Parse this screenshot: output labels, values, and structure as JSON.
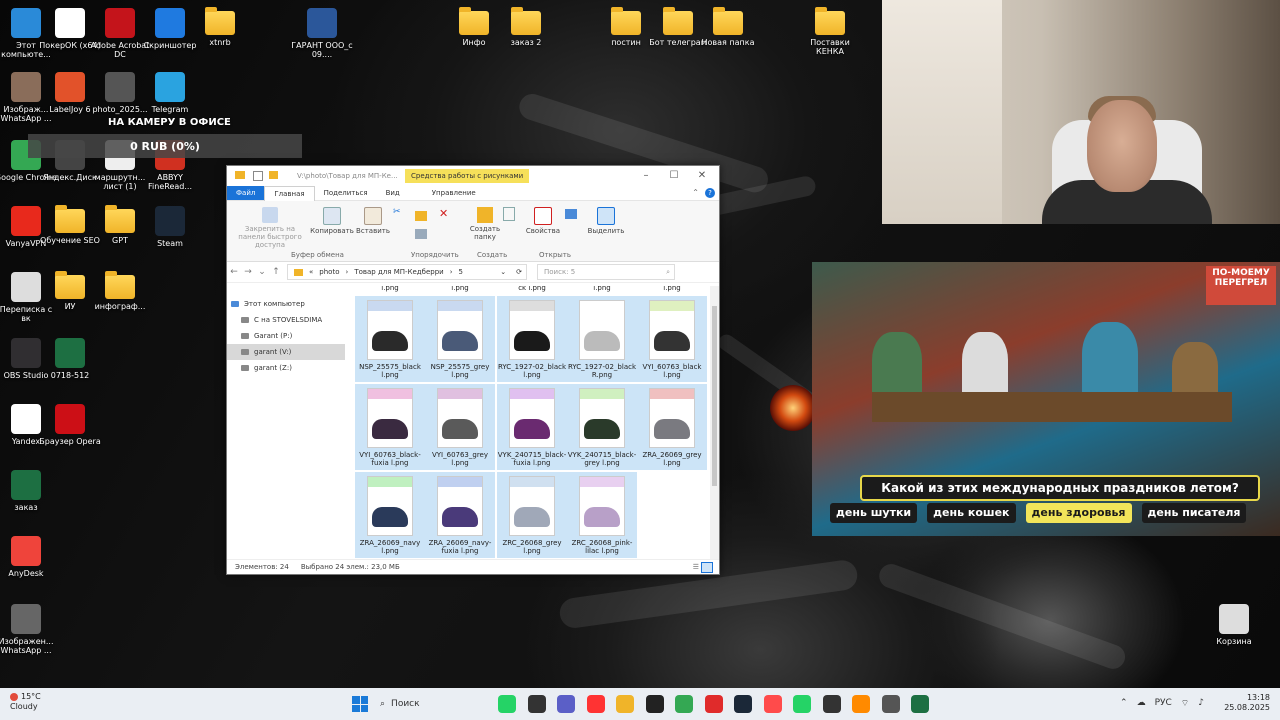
{
  "desktop": {
    "icons": [
      {
        "label": "Этот компьюте...",
        "icon": "computer-icon",
        "color": "#2a8ad8"
      },
      {
        "label": "ПокерОК (x64)",
        "icon": "poker-icon",
        "color": "#ffffff"
      },
      {
        "label": "Adobe Acrobat DC",
        "icon": "acrobat-icon",
        "color": "#c4141b"
      },
      {
        "label": "Скриншотер",
        "icon": "screenshot-icon",
        "color": "#1f7ae0"
      },
      {
        "label": "xtnrb",
        "icon": "folder-icon",
        "color": "#f0b429"
      },
      {
        "label": "ГАРАНТ ООО_с 09....",
        "icon": "word-icon",
        "color": "#2b579a"
      },
      {
        "label": "Изображ... WhatsApp ...",
        "icon": "image-icon",
        "color": "#8a6d5a"
      },
      {
        "label": "LabelJoy 6",
        "icon": "labeljoy-icon",
        "color": "#e2522a"
      },
      {
        "label": "photo_2025...",
        "icon": "image-icon",
        "color": "#555555"
      },
      {
        "label": "Telegram",
        "icon": "telegram-icon",
        "color": "#2aa3e0"
      },
      {
        "label": "Google Chrome",
        "icon": "chrome-icon",
        "color": "#34a853"
      },
      {
        "label": "Яндекс.Диск",
        "icon": "yandex-disk-icon",
        "color": "#444444"
      },
      {
        "label": "маршрутн... лист (1)",
        "icon": "document-icon",
        "color": "#eeeeee"
      },
      {
        "label": "ABBYY FineRead...",
        "icon": "abbyy-icon",
        "color": "#d03020"
      },
      {
        "label": "VanyaVPN",
        "icon": "vpn-icon",
        "color": "#e8291c"
      },
      {
        "label": "Обучение SEO",
        "icon": "folder-icon",
        "color": "#f0b429"
      },
      {
        "label": "GPT",
        "icon": "folder-icon",
        "color": "#f0b429"
      },
      {
        "label": "Steam",
        "icon": "steam-icon",
        "color": "#1b2838"
      },
      {
        "label": "Переписка с вк",
        "icon": "document-icon",
        "color": "#dddddd"
      },
      {
        "label": "ИУ",
        "icon": "folder-icon",
        "color": "#f0b429"
      },
      {
        "label": "инфограф...",
        "icon": "folder-icon",
        "color": "#f0b429"
      },
      {
        "label": "OBS Studio",
        "icon": "obs-icon",
        "color": "#302e31"
      },
      {
        "label": "0718-512",
        "icon": "excel-icon",
        "color": "#1d6f42"
      },
      {
        "label": "Yandex",
        "icon": "yandex-browser-icon",
        "color": "#ffffff"
      },
      {
        "label": "Браузер Opera",
        "icon": "opera-icon",
        "color": "#cc0f16"
      },
      {
        "label": "заказ",
        "icon": "excel-icon",
        "color": "#1d6f42"
      },
      {
        "label": "AnyDesk",
        "icon": "anydesk-icon",
        "color": "#ef443b"
      },
      {
        "label": "Изображен... WhatsApp ...",
        "icon": "image-icon",
        "color": "#666666"
      },
      {
        "label": "Инфо",
        "icon": "folder-icon",
        "color": "#f0b429"
      },
      {
        "label": "заказ 2",
        "icon": "folder-icon",
        "color": "#f0b429"
      },
      {
        "label": "постин",
        "icon": "folder-icon",
        "color": "#f0b429"
      },
      {
        "label": "Бот телеграм",
        "icon": "folder-icon",
        "color": "#f0b429"
      },
      {
        "label": "Новая папка",
        "icon": "folder-icon",
        "color": "#f0b429"
      },
      {
        "label": "Поставки КЕНКА",
        "icon": "folder-icon",
        "color": "#f0b429"
      },
      {
        "label": "Корзина",
        "icon": "recycle-bin-icon",
        "color": "#dddddd"
      }
    ],
    "camera_label": "НА КАМЕРУ В ОФИСЕ",
    "donation_bar": "0 RUB (0%)"
  },
  "explorer": {
    "title_path": "V:\\photo\\Товар для МП-Ке...",
    "tools_tab": "Средства работы с рисунками",
    "tabs": {
      "file": "Файл",
      "home": "Главная",
      "share": "Поделиться",
      "view": "Вид",
      "manage": "Управление"
    },
    "ribbon": {
      "pin": "Закрепить на панели быстрого доступа",
      "copy": "Копировать",
      "paste": "Вставить",
      "new_folder": "Создать папку",
      "properties": "Свойства",
      "select": "Выделить",
      "group_clipboard": "Буфер обмена",
      "group_organize": "Упорядочить",
      "group_new": "Создать",
      "group_open": "Открыть"
    },
    "address": {
      "crumbs": [
        "«",
        "photo",
        "›",
        "Товар для МП-Кедберри",
        "›",
        "5"
      ],
      "search_placeholder": "Поиск: 5"
    },
    "nav": [
      "Этот компьютер",
      "C на STOVELSDIMA",
      "Garant (P:)",
      "garant (V:)",
      "garant (Z:)"
    ],
    "top_labels": [
      "l.png",
      "l.png",
      "ck l.png",
      "l.png",
      "l.png"
    ],
    "files": [
      {
        "name": "NSP_25575_black l.png",
        "color": "#2a2a2a",
        "band": "#c9d9f0"
      },
      {
        "name": "NSP_25575_grey l.png",
        "color": "#4a5a78",
        "band": "#c9d9f0"
      },
      {
        "name": "RYC_1927-02_black l.png",
        "color": "#1a1a1a",
        "band": "#dddddd"
      },
      {
        "name": "RYC_1927-02_black R.png",
        "color": "#bbbbbb",
        "band": "#ffffff"
      },
      {
        "name": "VYI_60763_black l.png",
        "color": "#333333",
        "band": "#dff0c0"
      },
      {
        "name": "VYI_60763_black-fuxia l.png",
        "color": "#3a2a40",
        "band": "#f0c0e0"
      },
      {
        "name": "VYI_60763_grey l.png",
        "color": "#5a5a5a",
        "band": "#e0c0e0"
      },
      {
        "name": "VYK_240715_black-fuxia l.png",
        "color": "#6a2a70",
        "band": "#e0c0f0"
      },
      {
        "name": "VYK_240715_black-grey l.png",
        "color": "#2a3a2a",
        "band": "#d0f0c0"
      },
      {
        "name": "ZRA_26069_grey l.png",
        "color": "#7a7a80",
        "band": "#f0c0c0"
      },
      {
        "name": "ZRA_26069_navy l.png",
        "color": "#2a3a5a",
        "band": "#c0f0c0"
      },
      {
        "name": "ZRA_26069_navy-fuxia l.png",
        "color": "#4a3a7a",
        "band": "#c0d0f0"
      },
      {
        "name": "ZRC_26068_grey l.png",
        "color": "#a0a8b8",
        "band": "#d0e0f0"
      },
      {
        "name": "ZRC_26068_pink-lilac l.png",
        "color": "#b8a0c8",
        "band": "#e8d0f0"
      }
    ],
    "status": {
      "count": "Элементов: 24",
      "selected": "Выбрано 24 элем.: 23,0 МБ"
    }
  },
  "stream": {
    "badge": "ПО-МОЕМУ ПЕРЕГРЕЛ",
    "question": "Какой из этих международных праздников летом?",
    "answers": [
      "день шутки",
      "день кошек",
      "день здоровья",
      "день писателя"
    ]
  },
  "taskbar": {
    "weather_temp": "15°C",
    "weather_desc": "Cloudy",
    "search": "Поиск",
    "lang": "РУС",
    "time": "13:18",
    "date": "25.08.2025",
    "apps": [
      {
        "icon": "whatsapp-app-icon",
        "color": "#25d366"
      },
      {
        "icon": "task-view-icon",
        "color": "#333333"
      },
      {
        "icon": "teams-icon",
        "color": "#5b5fc7"
      },
      {
        "icon": "yandex-taskbar-icon",
        "color": "#ff3333"
      },
      {
        "icon": "explorer-taskbar-icon",
        "color": "#f0b429"
      },
      {
        "icon": "app-icon",
        "color": "#222222"
      },
      {
        "icon": "chrome-taskbar-icon",
        "color": "#34a853"
      },
      {
        "icon": "yandex-browser-taskbar-icon",
        "color": "#e02b2b"
      },
      {
        "icon": "steam-taskbar-icon",
        "color": "#1b2838"
      },
      {
        "icon": "obs-taskbar-icon",
        "color": "#ff4b4b"
      },
      {
        "icon": "whatsapp-taskbar-icon",
        "color": "#25d366"
      },
      {
        "icon": "pen-icon",
        "color": "#333333"
      },
      {
        "icon": "game-icon",
        "color": "#ff8a00"
      },
      {
        "icon": "color-icon",
        "color": "#555555"
      },
      {
        "icon": "excel-taskbar-icon",
        "color": "#1d6f42"
      }
    ]
  }
}
